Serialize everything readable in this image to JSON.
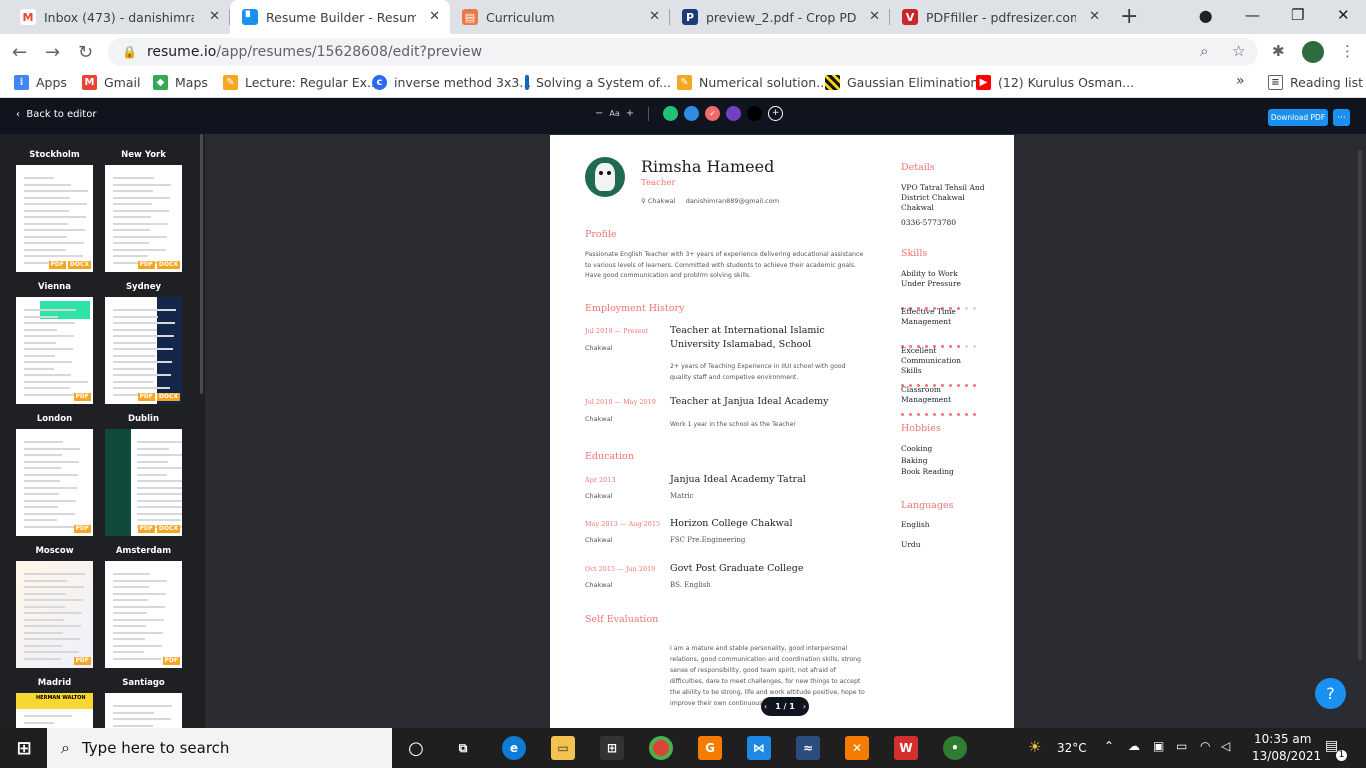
{
  "tabs": [
    {
      "title": "Inbox (473) - danishimran889",
      "icon": "gmail-icon",
      "color": "#ea4335",
      "glyph": "M"
    },
    {
      "title": "Resume Builder - Resume.io",
      "icon": "resume-icon",
      "color": "#1a91f0",
      "glyph": "▘"
    },
    {
      "title": "Curriculum",
      "icon": "slides-icon",
      "color": "#ee7844",
      "glyph": "▤"
    },
    {
      "title": "preview_2.pdf - Crop PDF file",
      "icon": "pdf-icon",
      "color": "#1b3b7a",
      "glyph": "P"
    },
    {
      "title": "PDFfiller - pdfresizer.com-pdf",
      "icon": "pdffiller-icon",
      "color": "#c8262b",
      "glyph": "V"
    }
  ],
  "address": {
    "host": "resume.io",
    "path": "/app/resumes/15628608/edit?preview"
  },
  "bookmarks": [
    {
      "label": "Apps",
      "icon": "apps-icon",
      "color": "#4285f4"
    },
    {
      "label": "Gmail",
      "icon": "gmail-icon",
      "color": "#ea4335"
    },
    {
      "label": "Maps",
      "icon": "maps-icon",
      "color": "#34a853"
    },
    {
      "label": "Lecture: Regular Ex...",
      "icon": "lecture-icon",
      "color": "#f5a623"
    },
    {
      "label": "inverse method 3x3...",
      "icon": "inverse-icon",
      "color": "#2c6bed"
    },
    {
      "label": "Solving a System of...",
      "icon": "solving-icon",
      "color": "#1565c0"
    },
    {
      "label": "Numerical solution...",
      "icon": "numerical-icon",
      "color": "#f5a623"
    },
    {
      "label": "Gaussian Elimination",
      "icon": "gaussian-icon",
      "color": "#111111"
    },
    {
      "label": "(12) Kurulus Osman...",
      "icon": "youtube-icon",
      "color": "#ff0000"
    }
  ],
  "reading_list": "Reading list",
  "header": {
    "back": "Back to editor",
    "font_label": "Aa",
    "download": "Download PDF",
    "more": "···"
  },
  "colors": [
    "#21c079",
    "#2e8be6",
    "#f16b6b",
    "#6e42c1",
    "#0f141e"
  ],
  "templates": [
    {
      "name": "Stockholm",
      "badges": [
        "PDF",
        "DOCX"
      ]
    },
    {
      "name": "New York",
      "badges": [
        "PDF",
        "DOCX"
      ]
    },
    {
      "name": "Vienna",
      "badges": [
        "PDF"
      ]
    },
    {
      "name": "Sydney",
      "badges": [
        "PDF",
        "DOCX"
      ]
    },
    {
      "name": "London",
      "badges": [
        "PDF"
      ]
    },
    {
      "name": "Dublin",
      "badges": [
        "PDF",
        "DOCX"
      ]
    },
    {
      "name": "Moscow",
      "badges": [
        "PDF"
      ]
    },
    {
      "name": "Amsterdam",
      "badges": [
        "PDF"
      ]
    },
    {
      "name": "Madrid",
      "badges": [],
      "banner": "HERMAN WALTON"
    },
    {
      "name": "Santiago",
      "badges": []
    }
  ],
  "resume": {
    "name": "Rimsha Hameed",
    "role": "Teacher",
    "location": "Chakwal",
    "email": "danishimran889@gmail.com",
    "profile_title": "Profile",
    "profile": "Passionate English Teacher with 3+ years of experience delivering educational assistance to various levels of learners. Committed with  students to achieve their academic goals. Have good communication and problrm solving skills.",
    "employment_title": "Employment History",
    "jobs": [
      {
        "date": "Jul 2019 — Present",
        "city": "Chakwal",
        "title": "Teacher at International Islamic University Islamabad, School",
        "desc": "2+ years of Teaching Experience in IIUI school with good quality staff and competive environment."
      },
      {
        "date": "Jul 2018 — May 2019",
        "city": "Chakwal",
        "title": "Teacher at Janjua Ideal Academy",
        "desc": "Work 1 year in the school as the Teacher"
      }
    ],
    "education_title": "Education",
    "education": [
      {
        "date": "Apr 2013",
        "city": "Chakwal",
        "title": "Janjua Ideal Academy Tatral",
        "desc": "Matric"
      },
      {
        "date": "May 2013 — Aug 2015",
        "city": "Chakwal",
        "title": "Horizon College Chakwal",
        "desc": "FSC Pre.Engineering"
      },
      {
        "date": "Oct 2015 — Jun 2019",
        "city": "Chakwal",
        "title": "Govt Post Graduate College",
        "desc": "BS. English"
      }
    ],
    "self_eval_title": "Self Evaluation",
    "self_eval": "I am a mature and stable personality, good interpersonal relations, good communication and coordination skills, strong sense of responsibility, good team spirit, not afraid of difficulties, dare to meet challenges, for new things to accept the ability to be strong, life and work attitude positive, hope to improve their own continuous",
    "details_title": "Details",
    "address": "VPO Tatral Tehsil And District Chakwal Chakwal",
    "phone": "0336-5773780",
    "skills_title": "Skills",
    "skills": [
      {
        "name": "Ability to Work Under Pressure",
        "level": 0.8
      },
      {
        "name": "Effective Time Management",
        "level": 0.8
      },
      {
        "name": "Excellent Communication Skills",
        "level": 1.0
      },
      {
        "name": "Classroom Management",
        "level": 1.0
      }
    ],
    "hobbies_title": "Hobbies",
    "hobbies": [
      "Cooking",
      "Baking",
      "Book Reading"
    ],
    "languages_title": "Languages",
    "languages": [
      "English",
      "Urdu"
    ]
  },
  "pager": "1 / 1",
  "help": "?",
  "taskbar": {
    "search": "Type here to search",
    "temp": "32°C",
    "time": "10:35 am",
    "date": "13/08/2021",
    "notif": "1"
  }
}
